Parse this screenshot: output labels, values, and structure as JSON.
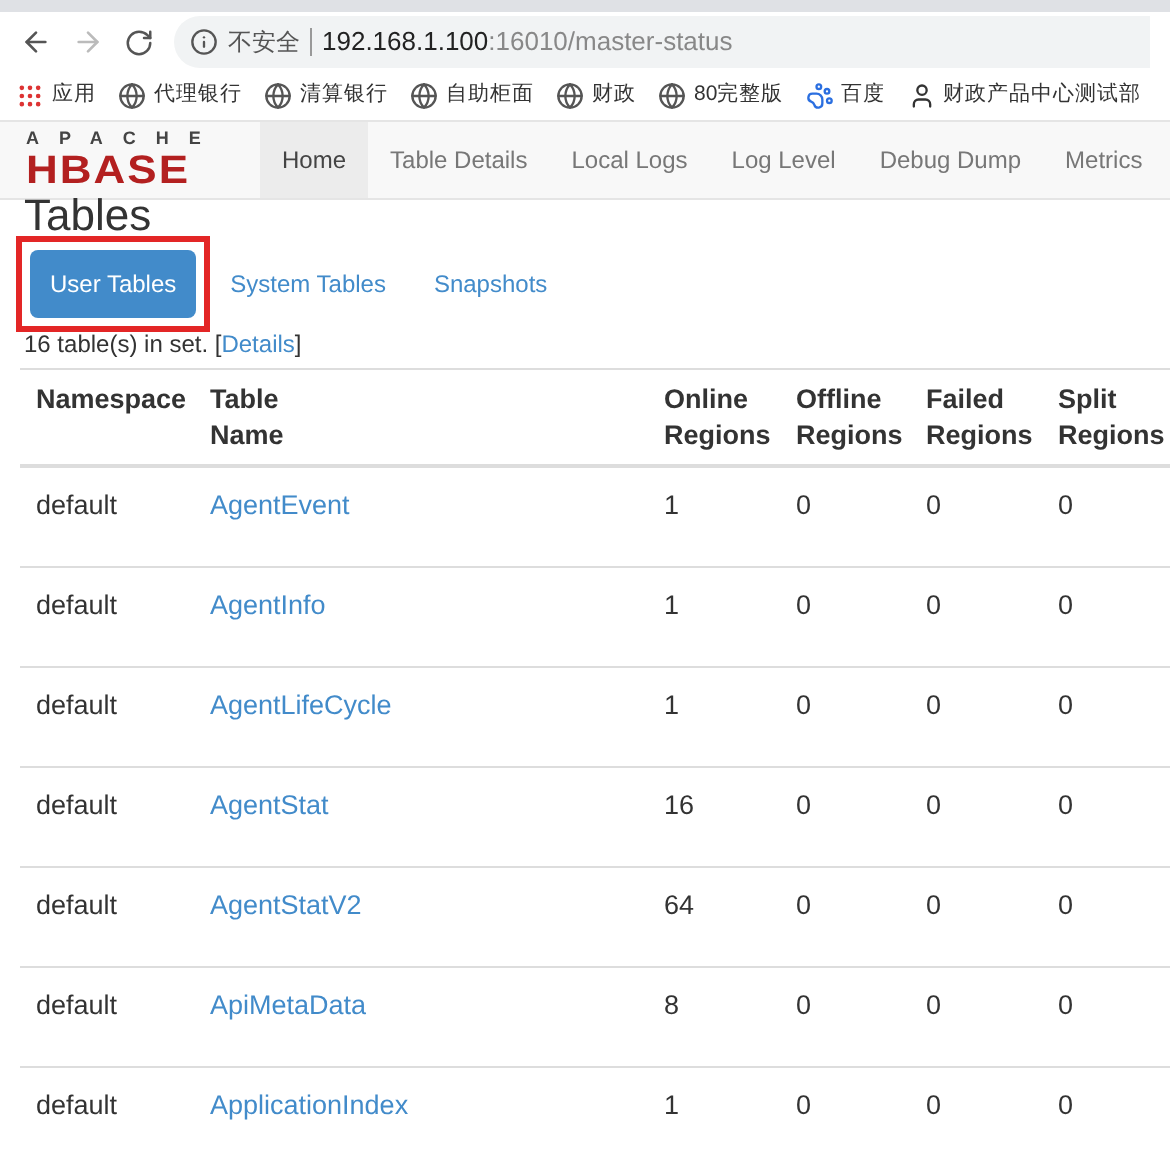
{
  "browser": {
    "forward_disabled": true,
    "security": "不安全",
    "host": "192.168.1.100",
    "path": ":16010/master-status"
  },
  "bookmarks": [
    {
      "kind": "apps",
      "label": "应用"
    },
    {
      "kind": "globe",
      "label": "代理银行"
    },
    {
      "kind": "globe",
      "label": "清算银行"
    },
    {
      "kind": "globe",
      "label": "自助柜面"
    },
    {
      "kind": "globe",
      "label": "财政"
    },
    {
      "kind": "globe",
      "label": "80完整版"
    },
    {
      "kind": "paw",
      "label": "百度"
    },
    {
      "kind": "figure",
      "label": "财政产品中心测试部"
    }
  ],
  "logo": {
    "top": "APACHE",
    "bottom": "HBASE"
  },
  "nav": [
    {
      "label": "Home",
      "selected": true
    },
    {
      "label": "Table Details",
      "selected": false
    },
    {
      "label": "Local Logs",
      "selected": false
    },
    {
      "label": "Log Level",
      "selected": false
    },
    {
      "label": "Debug Dump",
      "selected": false
    },
    {
      "label": "Metrics",
      "selected": false
    }
  ],
  "heading": "Tables",
  "tabs": [
    {
      "label": "User Tables",
      "selected": true,
      "highlighted": true
    },
    {
      "label": "System Tables",
      "selected": false,
      "highlighted": false
    },
    {
      "label": "Snapshots",
      "selected": false,
      "highlighted": false
    }
  ],
  "summary": {
    "text": "16 table(s) in set. [",
    "link": "Details",
    "end": "]"
  },
  "table": {
    "columns": [
      "Namespace",
      "Table Name",
      "Online Regions",
      "Offline Regions",
      "Failed Regions",
      "Split Regions"
    ],
    "rows": [
      [
        "default",
        "AgentEvent",
        "1",
        "0",
        "0",
        "0"
      ],
      [
        "default",
        "AgentInfo",
        "1",
        "0",
        "0",
        "0"
      ],
      [
        "default",
        "AgentLifeCycle",
        "1",
        "0",
        "0",
        "0"
      ],
      [
        "default",
        "AgentStat",
        "16",
        "0",
        "0",
        "0"
      ],
      [
        "default",
        "AgentStatV2",
        "64",
        "0",
        "0",
        "0"
      ],
      [
        "default",
        "ApiMetaData",
        "8",
        "0",
        "0",
        "0"
      ],
      [
        "default",
        "ApplicationIndex",
        "1",
        "0",
        "0",
        "0"
      ]
    ]
  }
}
